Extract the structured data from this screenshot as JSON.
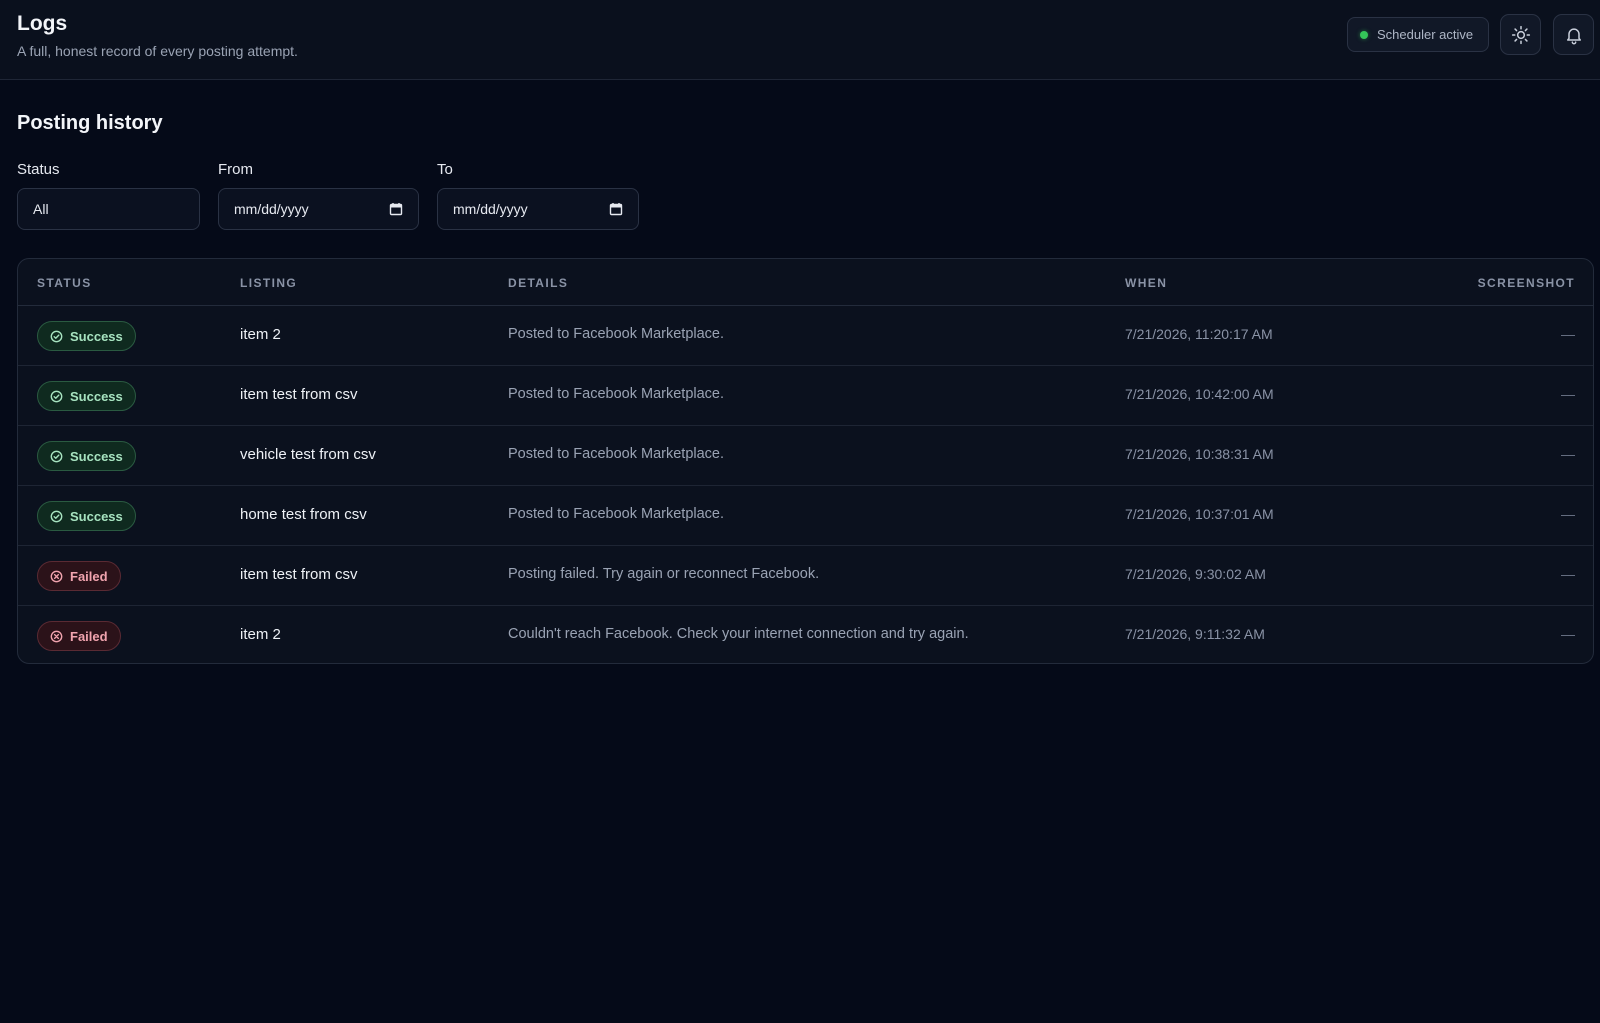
{
  "header": {
    "title": "Logs",
    "subtitle": "A full, honest record of every posting attempt.",
    "scheduler_label": "Scheduler active",
    "icons": [
      "sun-icon",
      "bell-icon"
    ]
  },
  "section": {
    "title": "Posting history"
  },
  "filters": {
    "status_label": "Status",
    "status_value": "All",
    "from_label": "From",
    "from_placeholder": "mm/dd/yyyy",
    "to_label": "To",
    "to_placeholder": "mm/dd/yyyy"
  },
  "table": {
    "columns": [
      "STATUS",
      "LISTING",
      "DETAILS",
      "WHEN",
      "SCREENSHOT"
    ],
    "rows": [
      {
        "status": "Success",
        "listing": "item 2",
        "details": "Posted to Facebook Marketplace.",
        "when": "7/21/2026, 11:20:17 AM",
        "screenshot": "—"
      },
      {
        "status": "Success",
        "listing": "item test from csv",
        "details": "Posted to Facebook Marketplace.",
        "when": "7/21/2026, 10:42:00 AM",
        "screenshot": "—"
      },
      {
        "status": "Success",
        "listing": "vehicle test from csv",
        "details": "Posted to Facebook Marketplace.",
        "when": "7/21/2026, 10:38:31 AM",
        "screenshot": "—"
      },
      {
        "status": "Success",
        "listing": "home test from csv",
        "details": "Posted to Facebook Marketplace.",
        "when": "7/21/2026, 10:37:01 AM",
        "screenshot": "—"
      },
      {
        "status": "Failed",
        "listing": "item test from csv",
        "details": "Posting failed. Try again or reconnect Facebook.",
        "when": "7/21/2026, 9:30:02 AM",
        "screenshot": "—"
      },
      {
        "status": "Failed",
        "listing": "item 2",
        "details": "Couldn't reach Facebook. Check your internet connection and try again.",
        "when": "7/21/2026, 9:11:32 AM",
        "screenshot": "—"
      }
    ]
  },
  "colors": {
    "background": "#050a18",
    "success": "#34c759",
    "failed": "#f0a3ae"
  }
}
